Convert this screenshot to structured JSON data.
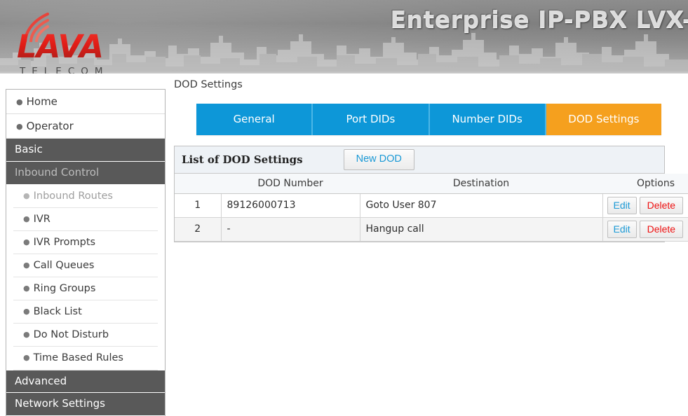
{
  "banner": {
    "product_title": "Enterprise IP-PBX LVX-",
    "logo_main": "LAVA",
    "logo_sub": "TELECOM"
  },
  "sidebar": {
    "top_items": [
      {
        "label": "Home",
        "bullet": "•"
      },
      {
        "label": "Operator",
        "bullet": "•"
      }
    ],
    "sections": [
      {
        "label": "Basic",
        "active": false
      },
      {
        "label": "Inbound Control",
        "active": true
      },
      {
        "label": "Advanced",
        "active": false
      },
      {
        "label": "Network Settings",
        "active": false
      }
    ],
    "inbound_items": [
      {
        "label": "Inbound Routes",
        "dim": true
      },
      {
        "label": "IVR",
        "dim": false
      },
      {
        "label": "IVR Prompts",
        "dim": false
      },
      {
        "label": "Call Queues",
        "dim": false
      },
      {
        "label": "Ring Groups",
        "dim": false
      },
      {
        "label": "Black List",
        "dim": false
      },
      {
        "label": "Do Not Disturb",
        "dim": false
      },
      {
        "label": "Time Based Rules",
        "dim": false
      }
    ]
  },
  "main": {
    "page_title": "DOD Settings",
    "tabs": [
      {
        "label": "General",
        "active": false
      },
      {
        "label": "Port DIDs",
        "active": false
      },
      {
        "label": "Number DIDs",
        "active": false
      },
      {
        "label": "DOD Settings",
        "active": true
      }
    ],
    "panel": {
      "title": "List of DOD Settings",
      "new_button": "New DOD",
      "columns": {
        "index": "",
        "dod_number": "DOD Number",
        "destination": "Destination",
        "options": "Options"
      },
      "rows": [
        {
          "index": "1",
          "dod_number": "89126000713",
          "destination": "Goto User 807",
          "edit": "Edit",
          "delete": "Delete"
        },
        {
          "index": "2",
          "dod_number": "-",
          "destination": "Hangup call",
          "edit": "Edit",
          "delete": "Delete"
        }
      ]
    }
  },
  "colors": {
    "tab_blue": "#0d97d8",
    "tab_active_orange": "#f5a01e",
    "link_blue": "#1c9ad6",
    "delete_red": "#ee1111",
    "sidebar_section_gray": "#595959",
    "logo_red": "#e01c16"
  }
}
